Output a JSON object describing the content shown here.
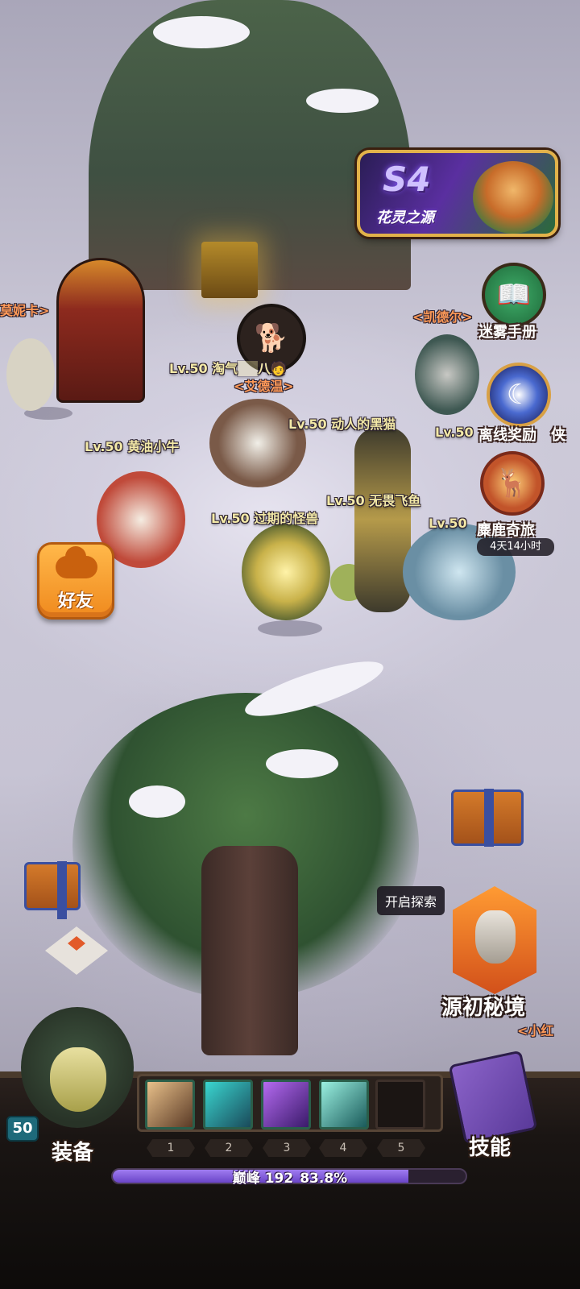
{
  "season": {
    "code": "S4",
    "name": "花灵之源",
    "accent": "#5a2fa0"
  },
  "npcs": {
    "left": "莫妮卡>",
    "edwin": "<艾德温>",
    "kader": "<凯德尔>",
    "bottom_right": "<小红"
  },
  "players": [
    {
      "level_name": "Lv.50 淘气",
      "suffix": "八🧑"
    },
    {
      "level_name": "Lv.50 动人的黑猫"
    },
    {
      "level_name": "Lv.50 黄油小牛"
    },
    {
      "level_name": "Lv.50 无畏飞鱼"
    },
    {
      "level_name": "Lv.50 过期的怪兽"
    },
    {
      "level_name": "Lv.50"
    },
    {
      "level_name": "Lv.50"
    }
  ],
  "side_menu": {
    "fog_manual": "迷雾手册",
    "offline_reward": "离线奖励",
    "offline_cut": "侠",
    "elk_journey": "麋鹿奇旅",
    "elk_timer": "4天14小时"
  },
  "friend_button": {
    "label": "好友"
  },
  "explore": {
    "tooltip": "开启探索",
    "realm_label": "源初秘境"
  },
  "bottom_bar": {
    "level": "50",
    "equip_label": "装备",
    "skill_label": "技能",
    "slots": [
      "1",
      "2",
      "3",
      "4",
      "5"
    ],
    "xp_level": "巅峰 192",
    "xp_percent_text": "83.8%",
    "xp_fraction": 0.838
  }
}
